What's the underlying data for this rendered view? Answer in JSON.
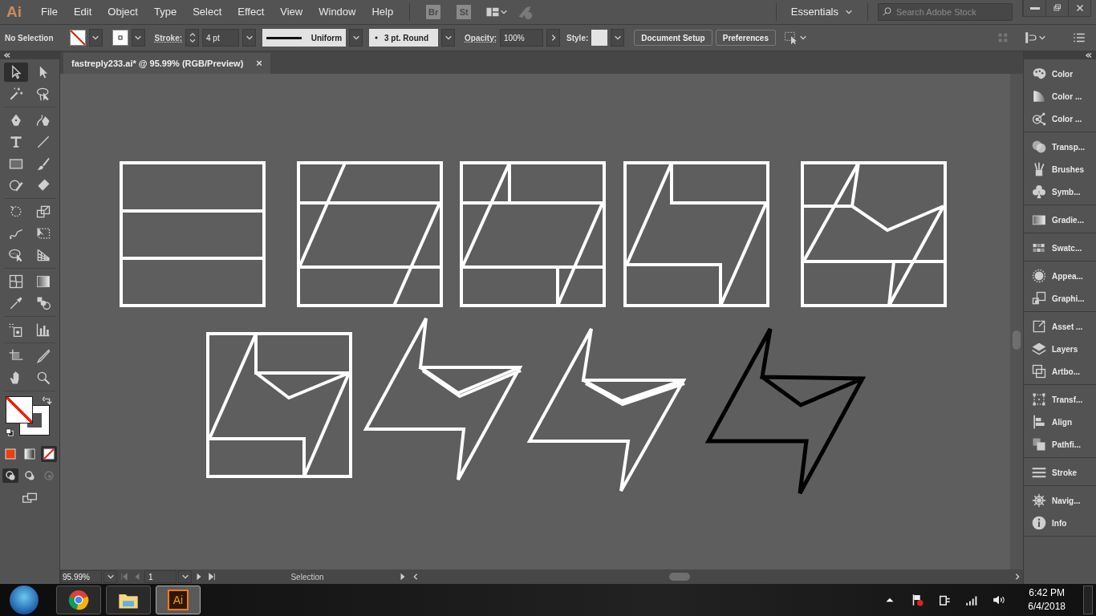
{
  "app": {
    "logo": "Ai",
    "menu": [
      "File",
      "Edit",
      "Object",
      "Type",
      "Select",
      "Effect",
      "View",
      "Window",
      "Help"
    ],
    "bridge": [
      "Br",
      "St"
    ],
    "workspace": "Essentials",
    "search": {
      "placeholder": "Search Adobe Stock"
    }
  },
  "control_bar": {
    "selection": "No Selection",
    "stroke_label": "Stroke:",
    "stroke_weight": "4 pt",
    "profile": "Uniform",
    "brush": "3 pt. Round",
    "opacity_label": "Opacity:",
    "opacity": "100%",
    "style_label": "Style:",
    "buttons": [
      "Document Setup",
      "Preferences"
    ]
  },
  "document_tab": {
    "title": "fastreply233.ai* @ 95.99% (RGB/Preview)",
    "close": "×"
  },
  "tool_groups": [
    [
      {
        "kind": "selection",
        "selected": true
      },
      {
        "kind": "direct-selection",
        "selected": false
      },
      {
        "kind": "magic-wand",
        "selected": false
      },
      {
        "kind": "lasso",
        "selected": false
      }
    ],
    [
      {
        "kind": "pen",
        "selected": false
      },
      {
        "kind": "curvature",
        "selected": false
      },
      {
        "kind": "type",
        "selected": false
      },
      {
        "kind": "line",
        "selected": false
      },
      {
        "kind": "rectangle",
        "selected": false
      },
      {
        "kind": "paintbrush",
        "selected": false
      },
      {
        "kind": "shaper",
        "selected": false
      },
      {
        "kind": "eraser",
        "selected": false
      }
    ],
    [
      {
        "kind": "rotate",
        "selected": false
      },
      {
        "kind": "scale",
        "selected": false
      },
      {
        "kind": "warp",
        "selected": false
      },
      {
        "kind": "free-transform",
        "selected": false
      },
      {
        "kind": "shape-builder",
        "selected": false
      },
      {
        "kind": "perspective",
        "selected": false
      }
    ],
    [
      {
        "kind": "mesh",
        "selected": false
      },
      {
        "kind": "gradient",
        "selected": false
      },
      {
        "kind": "eyedropper",
        "selected": false
      },
      {
        "kind": "blend",
        "selected": false
      }
    ],
    [
      {
        "kind": "symbol-sprayer",
        "selected": false
      },
      {
        "kind": "graph",
        "selected": false
      }
    ],
    [
      {
        "kind": "artboard",
        "selected": false
      },
      {
        "kind": "slice",
        "selected": false
      },
      {
        "kind": "hand",
        "selected": false
      },
      {
        "kind": "zoom",
        "selected": false
      }
    ]
  ],
  "color_modes": [
    {
      "kind": "color",
      "selected": false
    },
    {
      "kind": "gradient",
      "selected": false
    },
    {
      "kind": "none",
      "selected": true
    }
  ],
  "draw_modes": [
    {
      "kind": "normal",
      "selected": true
    },
    {
      "kind": "behind",
      "selected": false
    },
    {
      "kind": "inside",
      "selected": false
    }
  ],
  "panel_groups": [
    [
      {
        "kind": "color",
        "label": "Color"
      },
      {
        "kind": "color-guide",
        "label": "Color ..."
      },
      {
        "kind": "color-themes",
        "label": "Color ..."
      }
    ],
    [
      {
        "kind": "transparency",
        "label": "Transp..."
      },
      {
        "kind": "brushes",
        "label": "Brushes"
      },
      {
        "kind": "symbols",
        "label": "Symb..."
      }
    ],
    [
      {
        "kind": "gradient",
        "label": "Gradie..."
      }
    ],
    [
      {
        "kind": "swatches",
        "label": "Swatc..."
      }
    ],
    [
      {
        "kind": "appearance",
        "label": "Appea..."
      },
      {
        "kind": "graphic-styles",
        "label": "Graphi..."
      }
    ],
    [
      {
        "kind": "asset-export",
        "label": "Asset ..."
      },
      {
        "kind": "layers",
        "label": "Layers"
      },
      {
        "kind": "artboards",
        "label": "Artbo..."
      }
    ],
    [
      {
        "kind": "transform",
        "label": "Transf..."
      },
      {
        "kind": "align",
        "label": "Align"
      },
      {
        "kind": "pathfinder",
        "label": "Pathfi..."
      }
    ],
    [
      {
        "kind": "stroke",
        "label": "Stroke"
      }
    ],
    [
      {
        "kind": "navigator",
        "label": "Navig..."
      },
      {
        "kind": "info",
        "label": "Info"
      }
    ]
  ],
  "status_bar": {
    "zoom": "95.99%",
    "artboard": "1",
    "tool": "Selection"
  },
  "taskbar": {
    "apps": [
      {
        "kind": "chrome",
        "selected": false
      },
      {
        "kind": "explorer",
        "selected": false
      },
      {
        "kind": "illustrator",
        "label": "Ai",
        "selected": true
      }
    ],
    "time": "6:42 PM",
    "date": "6/4/2018"
  }
}
